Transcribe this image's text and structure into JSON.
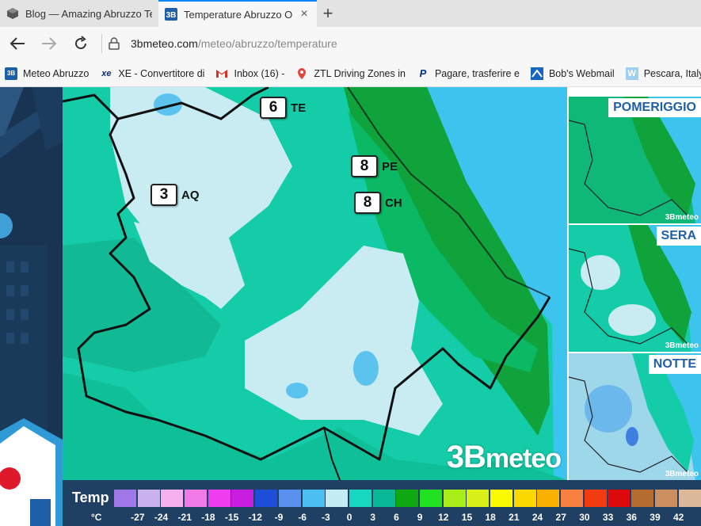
{
  "browser": {
    "tabs": [
      {
        "title": "Blog — Amazing Abruzzo Te",
        "active": false,
        "icon": "cube-icon"
      },
      {
        "title": "Temperature Abruzzo O",
        "active": true,
        "icon": "3b-meteo-icon"
      }
    ],
    "new_tab_label": "+",
    "close_glyph": "×",
    "url_host": "3bmeteo.com",
    "url_path": "/meteo/abruzzo/temperature"
  },
  "bookmarks": [
    {
      "label": "Meteo Abruzzo",
      "icon": "3b-meteo-icon",
      "color": "#1e5fa8"
    },
    {
      "label": "XE - Convertitore di",
      "icon": "xe-icon",
      "color": "#0b2e6e"
    },
    {
      "label": "Inbox (16) -",
      "icon": "gmail-icon",
      "color": "#d93025"
    },
    {
      "label": "ZTL Driving Zones in",
      "icon": "map-pin-icon",
      "color": "#e0463a"
    },
    {
      "label": "Pagare, trasferire e",
      "icon": "paypal-icon",
      "color": "#003087"
    },
    {
      "label": "Bob's Webmail",
      "icon": "webmail-icon",
      "color": "#1565c0"
    },
    {
      "label": "Pescara, Italy Travel",
      "icon": "w-icon",
      "color": "#5ca3d6"
    }
  ],
  "map": {
    "cities": [
      {
        "code": "TE",
        "temp": "6"
      },
      {
        "code": "AQ",
        "temp": "3"
      },
      {
        "code": "PE",
        "temp": "8"
      },
      {
        "code": "CH",
        "temp": "8"
      }
    ],
    "brand_b": "3B",
    "brand_text": "meteo"
  },
  "thumbnails": [
    {
      "label": "POMERIGGIO"
    },
    {
      "label": "SERA"
    },
    {
      "label": "NOTTE"
    }
  ],
  "thumb_brand": "3Bmeteo",
  "legend": {
    "title": "Temp",
    "unit": "°C",
    "ticks": [
      "-27",
      "-24",
      "-21",
      "-18",
      "-15",
      "-12",
      "-9",
      "-6",
      "-3",
      "0",
      "3",
      "6",
      "9",
      "12",
      "15",
      "18",
      "21",
      "24",
      "27",
      "30",
      "33",
      "36",
      "39",
      "42"
    ],
    "colors": [
      "#a077e6",
      "#c9b0ee",
      "#f6b0ee",
      "#f07ae8",
      "#ee3cee",
      "#c81ee0",
      "#1e4ed8",
      "#5a90ee",
      "#4cc0f2",
      "#c4ecf4",
      "#16d8c0",
      "#08b896",
      "#10a810",
      "#22e022",
      "#a8ec18",
      "#d8f018",
      "#fafa00",
      "#fad800",
      "#fab000",
      "#f88040",
      "#f23c10",
      "#dc0a0a",
      "#b46c30",
      "#cc9060",
      "#dcb89a"
    ]
  }
}
